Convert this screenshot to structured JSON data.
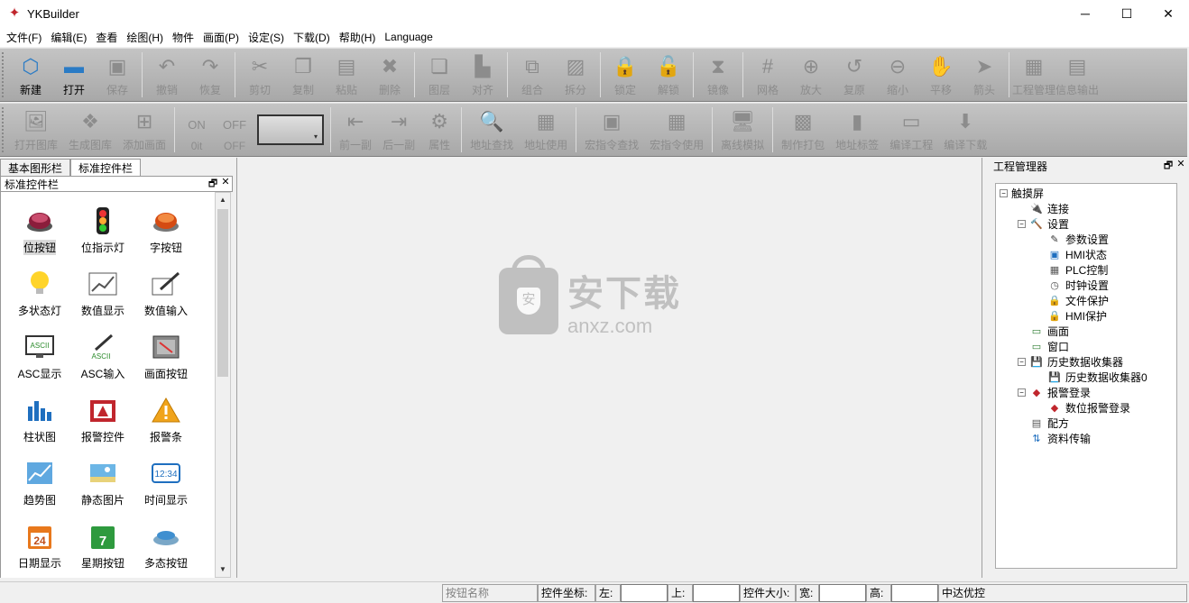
{
  "window": {
    "title": "YKBuilder",
    "minimize": "─",
    "maximize": "☐",
    "close": "✕"
  },
  "menu": [
    "文件(F)",
    "编辑(E)",
    "查看",
    "绘图(H)",
    "物件",
    "画面(P)",
    "设定(S)",
    "下载(D)",
    "帮助(H)",
    "Language"
  ],
  "toolbar1": [
    {
      "label": "新建",
      "icon": "new-icon",
      "glyph": "⬡",
      "active": true
    },
    {
      "label": "打开",
      "icon": "open-folder-icon",
      "glyph": "▬",
      "active": true
    },
    {
      "label": "保存",
      "icon": "save-icon",
      "glyph": "▣",
      "active": false
    },
    {
      "sep": true
    },
    {
      "label": "撤销",
      "icon": "undo-icon",
      "glyph": "↶",
      "active": false
    },
    {
      "label": "恢复",
      "icon": "redo-icon",
      "glyph": "↷",
      "active": false
    },
    {
      "sep": true
    },
    {
      "label": "剪切",
      "icon": "scissors-icon",
      "glyph": "✂",
      "active": false
    },
    {
      "label": "复制",
      "icon": "copy-icon",
      "glyph": "❐",
      "active": false
    },
    {
      "label": "粘贴",
      "icon": "paste-icon",
      "glyph": "▤",
      "active": false
    },
    {
      "label": "删除",
      "icon": "delete-icon",
      "glyph": "✖",
      "active": false
    },
    {
      "sep": true
    },
    {
      "label": "图层",
      "icon": "layer-icon",
      "glyph": "❏",
      "active": false
    },
    {
      "label": "对齐",
      "icon": "align-icon",
      "glyph": "▙",
      "active": false
    },
    {
      "sep": true
    },
    {
      "label": "组合",
      "icon": "group-icon",
      "glyph": "⧉",
      "active": false
    },
    {
      "label": "拆分",
      "icon": "ungroup-icon",
      "glyph": "▨",
      "active": false
    },
    {
      "sep": true
    },
    {
      "label": "锁定",
      "icon": "lock-icon",
      "glyph": "🔒",
      "active": false
    },
    {
      "label": "解锁",
      "icon": "unlock-icon",
      "glyph": "🔓",
      "active": false
    },
    {
      "sep": true
    },
    {
      "label": "镜像",
      "icon": "mirror-icon",
      "glyph": "⧗",
      "active": false
    },
    {
      "sep": true
    },
    {
      "label": "网格",
      "icon": "grid-icon",
      "glyph": "#",
      "active": false
    },
    {
      "label": "放大",
      "icon": "zoom-in-icon",
      "glyph": "⊕",
      "active": false
    },
    {
      "label": "复原",
      "icon": "restore-icon",
      "glyph": "↺",
      "active": false
    },
    {
      "label": "缩小",
      "icon": "zoom-out-icon",
      "glyph": "⊖",
      "active": false
    },
    {
      "label": "平移",
      "icon": "hand-icon",
      "glyph": "✋",
      "active": false
    },
    {
      "label": "箭头",
      "icon": "arrow-cursor-icon",
      "glyph": "➤",
      "active": false
    },
    {
      "sep": true
    },
    {
      "label": "工程管理",
      "icon": "project-manager-icon",
      "glyph": "▦",
      "active": false
    },
    {
      "label": "信息输出",
      "icon": "info-output-icon",
      "glyph": "▤",
      "active": false
    }
  ],
  "toolbar2": [
    {
      "label": "打开图库",
      "icon": "open-library-icon",
      "glyph": "🖼",
      "active": false
    },
    {
      "label": "生成图库",
      "icon": "create-library-icon",
      "glyph": "❖",
      "active": false
    },
    {
      "label": "添加画面",
      "icon": "add-screen-icon",
      "glyph": "⊞",
      "active": false
    },
    {
      "sep": true
    },
    {
      "label": "0it",
      "icon": "on-icon",
      "glyph": "ON",
      "active": false
    },
    {
      "label": "OFF",
      "icon": "off-icon",
      "glyph": "OFF",
      "active": false
    },
    {
      "color": true
    },
    {
      "sep": true
    },
    {
      "label": "前一副",
      "icon": "previous-screen-icon",
      "glyph": "⇤",
      "active": false
    },
    {
      "label": "后一副",
      "icon": "next-screen-icon",
      "glyph": "⇥",
      "active": false
    },
    {
      "label": "属性",
      "icon": "properties-icon",
      "glyph": "⚙",
      "active": false
    },
    {
      "sep": true
    },
    {
      "label": "地址查找",
      "icon": "address-search-icon",
      "glyph": "🔍",
      "active": false
    },
    {
      "label": "地址使用",
      "icon": "address-usage-icon",
      "glyph": "▦",
      "active": false
    },
    {
      "sep": true
    },
    {
      "label": "宏指令查找",
      "icon": "macro-search-icon",
      "glyph": "▣",
      "active": false
    },
    {
      "label": "宏指令使用",
      "icon": "macro-usage-icon",
      "glyph": "▦",
      "active": false
    },
    {
      "sep": true
    },
    {
      "label": "离线模拟",
      "icon": "offline-simulation-icon",
      "glyph": "🖥",
      "active": false
    },
    {
      "sep": true
    },
    {
      "label": "制作打包",
      "icon": "package-icon",
      "glyph": "▩",
      "active": false
    },
    {
      "label": "地址标签",
      "icon": "address-tag-icon",
      "glyph": "▮",
      "active": false
    },
    {
      "label": "编译工程",
      "icon": "compile-icon",
      "glyph": "▭",
      "active": false
    },
    {
      "label": "编译下载",
      "icon": "compile-download-icon",
      "glyph": "⬇",
      "active": false
    }
  ],
  "left": {
    "tabs": [
      "基本图形栏",
      "标准控件栏"
    ],
    "panel_title": "标准控件栏",
    "items": [
      {
        "label": "位按钮",
        "icon": "bit-button-icon"
      },
      {
        "label": "位指示灯",
        "icon": "bit-indicator-icon"
      },
      {
        "label": "字按钮",
        "icon": "word-button-icon"
      },
      {
        "label": "多状态灯",
        "icon": "multistate-lamp-icon"
      },
      {
        "label": "数值显示",
        "icon": "numeric-display-icon"
      },
      {
        "label": "数值输入",
        "icon": "numeric-input-icon"
      },
      {
        "label": "ASC显示",
        "icon": "ascii-display-icon"
      },
      {
        "label": "ASC输入",
        "icon": "ascii-input-icon"
      },
      {
        "label": "画面按钮",
        "icon": "screen-button-icon"
      },
      {
        "label": "柱状图",
        "icon": "bar-chart-icon"
      },
      {
        "label": "报警控件",
        "icon": "alarm-control-icon"
      },
      {
        "label": "报警条",
        "icon": "alarm-bar-icon"
      },
      {
        "label": "趋势图",
        "icon": "trend-chart-icon"
      },
      {
        "label": "静态图片",
        "icon": "static-picture-icon"
      },
      {
        "label": "时间显示",
        "icon": "time-display-icon"
      },
      {
        "label": "日期显示",
        "icon": "date-display-icon"
      },
      {
        "label": "星期按钮",
        "icon": "weekday-button-icon"
      },
      {
        "label": "多态按钮",
        "icon": "multistate-button-icon"
      }
    ],
    "clock_text": "12:34",
    "date_text": "24",
    "week_text": "7",
    "ascii_text": "ASCII"
  },
  "watermark": {
    "cn": "安下载",
    "en": "anxz.com",
    "shield": "安"
  },
  "right": {
    "title": "工程管理器",
    "tree": [
      {
        "label": "触摸屏",
        "level": 0,
        "exp": "−",
        "icon": ""
      },
      {
        "label": "连接",
        "level": 1,
        "icon": "connection-icon"
      },
      {
        "label": "设置",
        "level": 1,
        "exp": "−",
        "icon": "settings-hammer-icon"
      },
      {
        "label": "参数设置",
        "level": 2,
        "icon": "parameter-settings-icon"
      },
      {
        "label": "HMI状态",
        "level": 2,
        "icon": "hmi-status-icon"
      },
      {
        "label": "PLC控制",
        "level": 2,
        "icon": "plc-control-icon"
      },
      {
        "label": "时钟设置",
        "level": 2,
        "icon": "clock-settings-icon"
      },
      {
        "label": "文件保护",
        "level": 2,
        "icon": "file-protection-lock-icon"
      },
      {
        "label": "HMI保护",
        "level": 2,
        "icon": "hmi-protection-lock-icon"
      },
      {
        "label": "画面",
        "level": 1,
        "icon": "screen-window-icon"
      },
      {
        "label": "窗口",
        "level": 1,
        "icon": "window-icon"
      },
      {
        "label": "历史数据收集器",
        "level": 1,
        "exp": "−",
        "icon": "history-collector-icon"
      },
      {
        "label": "历史数据收集器0",
        "level": 2,
        "icon": "history-collector-icon"
      },
      {
        "label": "报警登录",
        "level": 1,
        "exp": "−",
        "icon": "alarm-log-icon"
      },
      {
        "label": "数位报警登录",
        "level": 2,
        "icon": "alarm-log-icon"
      },
      {
        "label": "配方",
        "level": 1,
        "icon": "recipe-icon"
      },
      {
        "label": "资料传输",
        "level": 1,
        "icon": "data-transfer-icon"
      }
    ]
  },
  "status": {
    "button_name": "按钮名称",
    "coord_label": "控件坐标:",
    "left_label": "左:",
    "left_value": "",
    "top_label": "上:",
    "top_value": "",
    "size_label": "控件大小:",
    "width_label": "宽:",
    "width_value": "",
    "height_label": "高:",
    "height_value": "",
    "vendor": "中达优控"
  }
}
